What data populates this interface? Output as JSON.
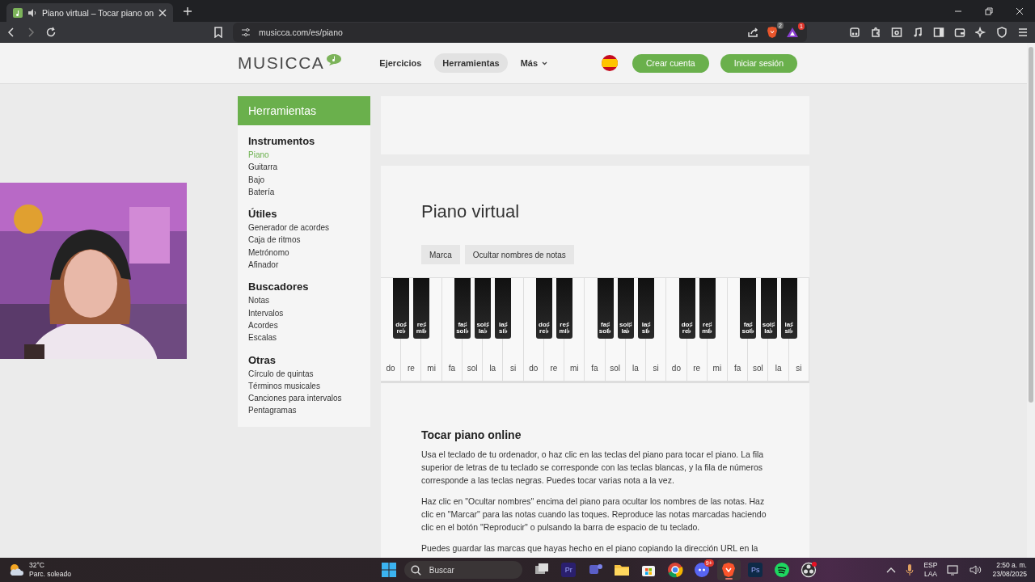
{
  "browser": {
    "tab": {
      "title": "Piano virtual – Tocar piano on",
      "selected": true
    },
    "address": "musicca.com/es/piano",
    "shield_count": "2",
    "rewards_count": "1"
  },
  "site": {
    "logo": "MUSICCA",
    "nav": [
      {
        "label": "Ejercicios",
        "selected": false
      },
      {
        "label": "Herramientas",
        "selected": true
      },
      {
        "label": "Más",
        "selected": false
      }
    ],
    "account_buttons": [
      "Crear cuenta",
      "Iniciar sesión"
    ]
  },
  "sidebar": {
    "title": "Herramientas",
    "sections": [
      {
        "heading": "Instrumentos",
        "items": [
          {
            "label": "Piano",
            "selected": true
          },
          {
            "label": "Guitarra",
            "selected": false
          },
          {
            "label": "Bajo",
            "selected": false
          },
          {
            "label": "Batería",
            "selected": false
          }
        ]
      },
      {
        "heading": "Útiles",
        "items": [
          {
            "label": "Generador de acordes",
            "selected": false
          },
          {
            "label": "Caja de ritmos",
            "selected": false
          },
          {
            "label": "Metrónomo",
            "selected": false
          },
          {
            "label": "Afinador",
            "selected": false
          }
        ]
      },
      {
        "heading": "Buscadores",
        "items": [
          {
            "label": "Notas",
            "selected": false
          },
          {
            "label": "Intervalos",
            "selected": false
          },
          {
            "label": "Acordes",
            "selected": false
          },
          {
            "label": "Escalas",
            "selected": false
          }
        ]
      },
      {
        "heading": "Otras",
        "items": [
          {
            "label": "Círculo de quintas",
            "selected": false
          },
          {
            "label": "Términos musicales",
            "selected": false
          },
          {
            "label": "Canciones para intervalos",
            "selected": false
          },
          {
            "label": "Pentagramas",
            "selected": false
          }
        ]
      }
    ]
  },
  "main": {
    "title": "Piano virtual",
    "buttons": [
      "Marca",
      "Ocultar nombres de notas"
    ],
    "piano": {
      "white_keys": [
        "do",
        "re",
        "mi",
        "fa",
        "sol",
        "la",
        "si",
        "do",
        "re",
        "mi",
        "fa",
        "sol",
        "la",
        "si",
        "do",
        "re",
        "mi",
        "fa",
        "sol",
        "la",
        "si"
      ],
      "black_keys": [
        {
          "upper": "do♯",
          "lower": "re♭"
        },
        {
          "upper": "re♯",
          "lower": "mi♭"
        },
        {
          "upper": "fa♯",
          "lower": "sol♭"
        },
        {
          "upper": "sol♯",
          "lower": "la♭"
        },
        {
          "upper": "la♯",
          "lower": "si♭"
        },
        {
          "upper": "do♯",
          "lower": "re♭"
        },
        {
          "upper": "re♯",
          "lower": "mi♭"
        },
        {
          "upper": "fa♯",
          "lower": "sol♭"
        },
        {
          "upper": "sol♯",
          "lower": "la♭"
        },
        {
          "upper": "la♯",
          "lower": "si♭"
        },
        {
          "upper": "do♯",
          "lower": "re♭"
        },
        {
          "upper": "re♯",
          "lower": "mi♭"
        },
        {
          "upper": "fa♯",
          "lower": "sol♭"
        },
        {
          "upper": "sol♯",
          "lower": "la♭"
        },
        {
          "upper": "la♯",
          "lower": "si♭"
        }
      ]
    },
    "section_title": "Tocar piano online",
    "paragraphs": [
      "Usa el teclado de tu ordenador, o haz clic en las teclas del piano para tocar el piano. La fila superior de letras de tu teclado se corresponde con las teclas blancas, y la fila de números corresponde a las teclas negras. Puedes tocar varias nota a la vez.",
      "Haz clic en \"Ocultar nombres\" encima del piano para ocultar los nombres de las notas. Haz clic en \"Marcar\" para las notas cuando las toques. Reproduce las notas marcadas haciendo clic en el botón \"Reproducir\" o pulsando la barra de espacio de tu teclado.",
      "Puedes guardar las marcas que hayas hecho en el piano copiando la dirección URL en la"
    ]
  },
  "taskbar": {
    "weather": {
      "temperature": "32°C",
      "condition": "Parc. soleado"
    },
    "search_placeholder": "Buscar",
    "apps": [
      {
        "kind": "taskview"
      },
      {
        "kind": "label",
        "label": "Pr",
        "color": "#2a1f6e"
      },
      {
        "kind": "teams"
      },
      {
        "kind": "folder"
      },
      {
        "kind": "store"
      },
      {
        "kind": "chrome"
      },
      {
        "kind": "discord",
        "badge": "9+"
      },
      {
        "kind": "brave",
        "selected": true
      },
      {
        "kind": "label",
        "label": "Ps",
        "color": "#0e2a47"
      },
      {
        "kind": "spotify"
      },
      {
        "kind": "obs"
      }
    ],
    "language": [
      "ESP",
      "LAA"
    ],
    "time": "2:50 a. m.",
    "date": "23/08/2025"
  }
}
